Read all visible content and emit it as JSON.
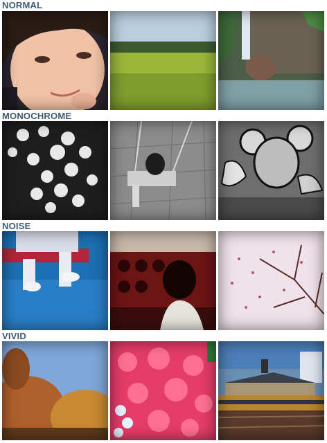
{
  "sections": [
    {
      "title": "NORMAL"
    },
    {
      "title": "MONOCHROME"
    },
    {
      "title": "NOISE"
    },
    {
      "title": "VIVID"
    }
  ]
}
